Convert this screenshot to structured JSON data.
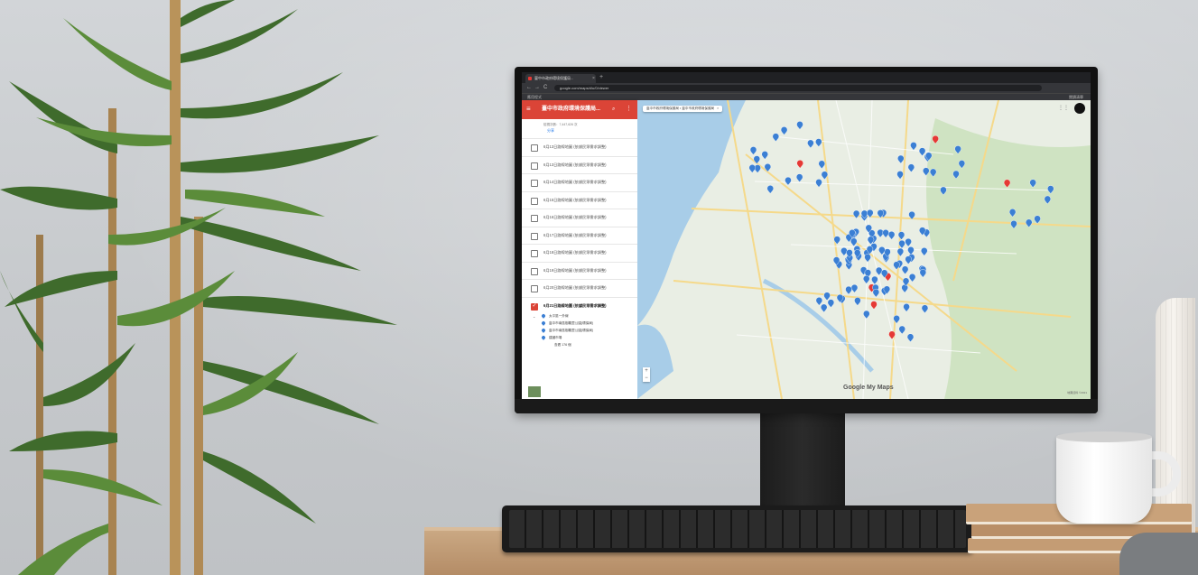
{
  "browser": {
    "tab_title": "臺中市政府環境保護局...",
    "tab_close": "×",
    "new_tab": "+",
    "url": "google.com/maps/d/u/0/viewer",
    "bookmark_left": "應用程式",
    "bookmark_right": "閱讀清單",
    "nav_back": "←",
    "nav_forward": "→",
    "nav_reload": "C"
  },
  "panel": {
    "title": "臺中市政府環境保護局...",
    "menu_icon": "≡",
    "search_icon": "⌕",
    "more_icon": "⋮",
    "meta": "檢視次數：7,447,626 次",
    "share": "分享",
    "layers": [
      {
        "label": "6月13日路線地圖 (依據民眾需求調整)",
        "checked": false
      },
      {
        "label": "6月13日路線地圖 (依據民眾需求調整)",
        "checked": false
      },
      {
        "label": "6月14日路線地圖 (依據民眾需求調整)",
        "checked": false
      },
      {
        "label": "6月15日路線地圖 (依據民眾需求調整)",
        "checked": false
      },
      {
        "label": "6月16日路線地圖 (依據民眾需求調整)",
        "checked": false
      },
      {
        "label": "6月17日路線地圖 (依據民眾需求調整)",
        "checked": false
      },
      {
        "label": "6月18日路線地圖 (依據民眾需求調整)",
        "checked": false
      },
      {
        "label": "6月19日路線地圖 (依據民眾需求調整)",
        "checked": false
      },
      {
        "label": "6月20日路線地圖 (依據民眾需求調整)",
        "checked": false
      },
      {
        "label": "6月21日路線地圖 (依據民眾需求調整)",
        "checked": true
      }
    ],
    "sub_items": [
      {
        "label": "太平區一外線"
      },
      {
        "label": "臺中市南區樹義里公園(環保局)"
      },
      {
        "label": "臺中市南區樹義里公園(環保局)"
      },
      {
        "label": "建國市場"
      }
    ],
    "sub_more": "查看 176 個"
  },
  "map": {
    "chip": "臺中市政府環境保護局 • 臺中市政府環境保護局",
    "chip_close": "×",
    "zoom_in": "+",
    "zoom_out": "−",
    "logo": "Google My Maps",
    "footer": "地圖資料 ©2021",
    "colors": {
      "land": "#e9eee4",
      "water": "#a8cde8",
      "green": "#cfe3c2",
      "road": "#f5d98a",
      "pin": "#3b7fd4",
      "pin_red": "#e53935"
    },
    "pin_count_shown": "176"
  }
}
